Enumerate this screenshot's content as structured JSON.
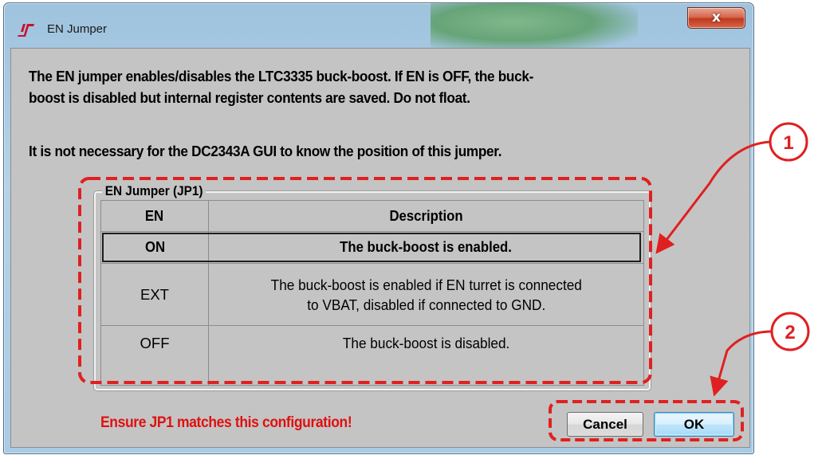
{
  "window": {
    "title": "EN Jumper",
    "close_glyph": "x",
    "icon": "linear-technology-logo"
  },
  "message": {
    "line1": "The EN jumper enables/disables the LTC3335 buck-boost. If EN is OFF, the buck-",
    "line2": "boost is disabled but internal register contents are saved. Do not float.",
    "line3": "It is not necessary for the DC2343A GUI to know the position of this jumper."
  },
  "group": {
    "title": "EN Jumper (JP1)",
    "headers": [
      "EN",
      "Description"
    ],
    "rows": [
      {
        "en": "ON",
        "desc": "The buck-boost is enabled.",
        "selected": true
      },
      {
        "en": "EXT",
        "desc_line1": "The buck-boost is enabled if EN turret is connected",
        "desc_line2": "to VBAT, disabled if connected to GND."
      },
      {
        "en": "OFF",
        "desc": "The buck-boost is disabled."
      }
    ]
  },
  "footer": {
    "warning": "Ensure JP1 matches this configuration!",
    "cancel_label": "Cancel",
    "ok_label": "OK"
  },
  "annotations": {
    "callout1": "1",
    "callout2": "2",
    "color": "#e02020"
  },
  "colors": {
    "dialog_bg": "#c4c4c4",
    "warning_text": "#e01010",
    "accent_ok": "#3c7fb1"
  }
}
